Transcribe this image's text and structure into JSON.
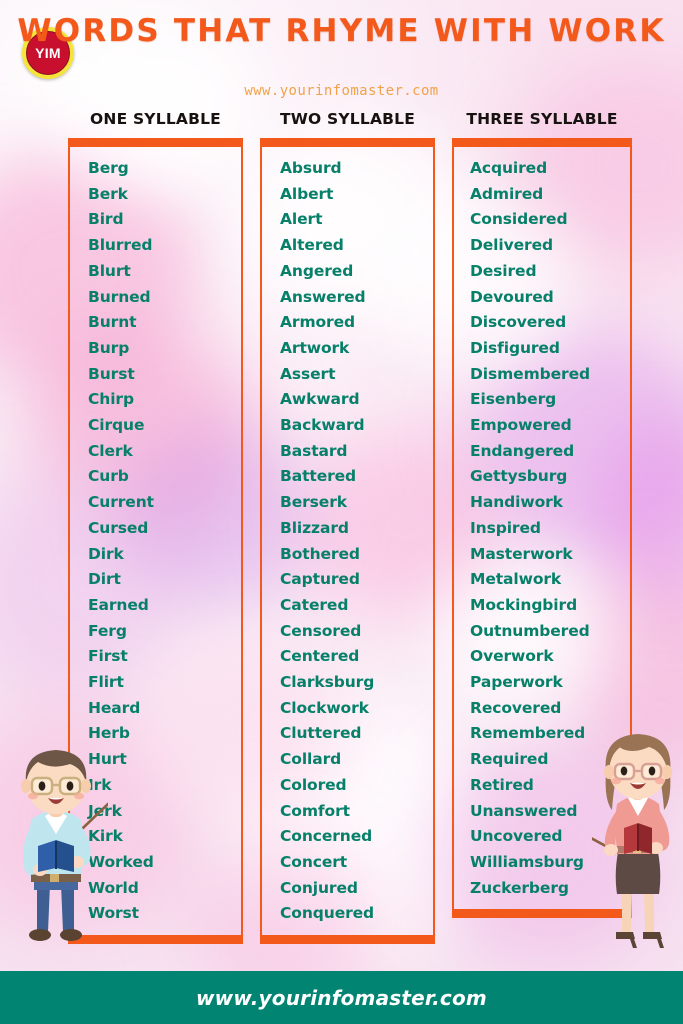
{
  "brand": {
    "logo_text": "YIM",
    "logo_ring_color": "#f5e53a",
    "logo_disc_color": "#c8102e"
  },
  "header": {
    "title": "WORDS THAT RHYME WITH WORK",
    "title_color": "#f4591c",
    "subtitle": "www.yourinfomaster.com",
    "subtitle_color": "#f2a24a"
  },
  "theme": {
    "word_color": "#07806a",
    "frame_color": "#f4591c",
    "footer_bg": "#018472",
    "heading_color": "#17120f"
  },
  "columns": [
    {
      "heading": "ONE SYLLABLE",
      "words": [
        "Berg",
        "Berk",
        "Bird",
        "Blurred",
        "Blurt",
        "Burned",
        "Burnt",
        "Burp",
        "Burst",
        "Chirp",
        "Cirque",
        "Clerk",
        "Curb",
        "Current",
        "Cursed",
        "Dirk",
        "Dirt",
        "Earned",
        "Ferg",
        "First",
        "Flirt",
        "Heard",
        "Herb",
        "Hurt",
        "Irk",
        "Jerk",
        "Kirk",
        "Worked",
        "World",
        "Worst"
      ]
    },
    {
      "heading": "TWO SYLLABLE",
      "words": [
        "Absurd",
        "Albert",
        "Alert",
        "Altered",
        "Angered",
        "Answered",
        "Armored",
        "Artwork",
        "Assert",
        "Awkward",
        "Backward",
        "Bastard",
        "Battered",
        "Berserk",
        "Blizzard",
        "Bothered",
        "Captured",
        "Catered",
        "Censored",
        "Centered",
        "Clarksburg",
        "Clockwork",
        "Cluttered",
        "Collard",
        "Colored",
        "Comfort",
        "Concerned",
        "Concert",
        "Conjured",
        "Conquered"
      ]
    },
    {
      "heading": "THREE SYLLABLE",
      "words": [
        "Acquired",
        "Admired",
        "Considered",
        "Delivered",
        "Desired",
        "Devoured",
        "Discovered",
        "Disfigured",
        "Dismembered",
        "Eisenberg",
        "Empowered",
        "Endangered",
        "Gettysburg",
        "Handiwork",
        "Inspired",
        "Masterwork",
        "Metalwork",
        "Mockingbird",
        "Outnumbered",
        "Overwork",
        "Paperwork",
        "Recovered",
        "Remembered",
        "Required",
        "Retired",
        "Unanswered",
        "Uncovered",
        "Williamsburg",
        "Zuckerberg"
      ]
    }
  ],
  "footer": {
    "website": "www.yourinfomaster.com"
  },
  "illustrations": {
    "left_character": "male-teacher-with-pointer",
    "right_character": "female-teacher-with-pointer"
  }
}
